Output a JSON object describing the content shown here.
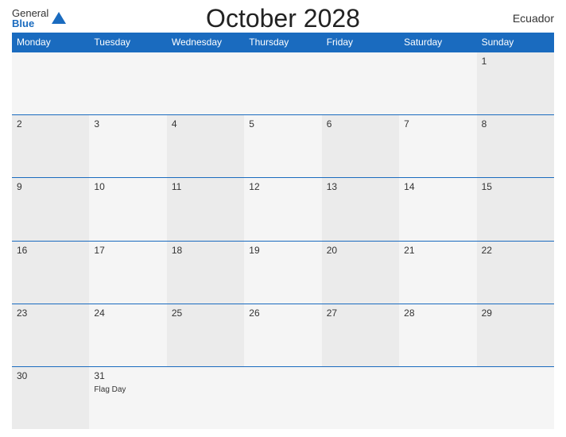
{
  "header": {
    "logo": {
      "general": "General",
      "blue": "Blue"
    },
    "title": "October 2028",
    "country": "Ecuador"
  },
  "calendar": {
    "weekdays": [
      "Monday",
      "Tuesday",
      "Wednesday",
      "Thursday",
      "Friday",
      "Saturday",
      "Sunday"
    ],
    "weeks": [
      [
        {
          "day": "",
          "col": 0,
          "empty": true
        },
        {
          "day": "",
          "col": 1,
          "empty": true
        },
        {
          "day": "",
          "col": 2,
          "empty": true
        },
        {
          "day": "",
          "col": 3,
          "empty": true
        },
        {
          "day": "",
          "col": 4,
          "empty": true
        },
        {
          "day": "",
          "col": 5,
          "empty": true
        },
        {
          "day": "1",
          "col": 6,
          "empty": false,
          "event": ""
        }
      ],
      [
        {
          "day": "2",
          "col": 0,
          "empty": false,
          "event": ""
        },
        {
          "day": "3",
          "col": 1,
          "empty": false,
          "event": ""
        },
        {
          "day": "4",
          "col": 2,
          "empty": false,
          "event": ""
        },
        {
          "day": "5",
          "col": 3,
          "empty": false,
          "event": ""
        },
        {
          "day": "6",
          "col": 4,
          "empty": false,
          "event": ""
        },
        {
          "day": "7",
          "col": 5,
          "empty": false,
          "event": ""
        },
        {
          "day": "8",
          "col": 6,
          "empty": false,
          "event": ""
        }
      ],
      [
        {
          "day": "9",
          "col": 0,
          "empty": false,
          "event": ""
        },
        {
          "day": "10",
          "col": 1,
          "empty": false,
          "event": ""
        },
        {
          "day": "11",
          "col": 2,
          "empty": false,
          "event": ""
        },
        {
          "day": "12",
          "col": 3,
          "empty": false,
          "event": ""
        },
        {
          "day": "13",
          "col": 4,
          "empty": false,
          "event": ""
        },
        {
          "day": "14",
          "col": 5,
          "empty": false,
          "event": ""
        },
        {
          "day": "15",
          "col": 6,
          "empty": false,
          "event": ""
        }
      ],
      [
        {
          "day": "16",
          "col": 0,
          "empty": false,
          "event": ""
        },
        {
          "day": "17",
          "col": 1,
          "empty": false,
          "event": ""
        },
        {
          "day": "18",
          "col": 2,
          "empty": false,
          "event": ""
        },
        {
          "day": "19",
          "col": 3,
          "empty": false,
          "event": ""
        },
        {
          "day": "20",
          "col": 4,
          "empty": false,
          "event": ""
        },
        {
          "day": "21",
          "col": 5,
          "empty": false,
          "event": ""
        },
        {
          "day": "22",
          "col": 6,
          "empty": false,
          "event": ""
        }
      ],
      [
        {
          "day": "23",
          "col": 0,
          "empty": false,
          "event": ""
        },
        {
          "day": "24",
          "col": 1,
          "empty": false,
          "event": ""
        },
        {
          "day": "25",
          "col": 2,
          "empty": false,
          "event": ""
        },
        {
          "day": "26",
          "col": 3,
          "empty": false,
          "event": ""
        },
        {
          "day": "27",
          "col": 4,
          "empty": false,
          "event": ""
        },
        {
          "day": "28",
          "col": 5,
          "empty": false,
          "event": ""
        },
        {
          "day": "29",
          "col": 6,
          "empty": false,
          "event": ""
        }
      ],
      [
        {
          "day": "30",
          "col": 0,
          "empty": false,
          "event": ""
        },
        {
          "day": "31",
          "col": 1,
          "empty": false,
          "event": "Flag Day"
        },
        {
          "day": "",
          "col": 2,
          "empty": true
        },
        {
          "day": "",
          "col": 3,
          "empty": true
        },
        {
          "day": "",
          "col": 4,
          "empty": true
        },
        {
          "day": "",
          "col": 5,
          "empty": true
        },
        {
          "day": "",
          "col": 6,
          "empty": true
        }
      ]
    ]
  }
}
